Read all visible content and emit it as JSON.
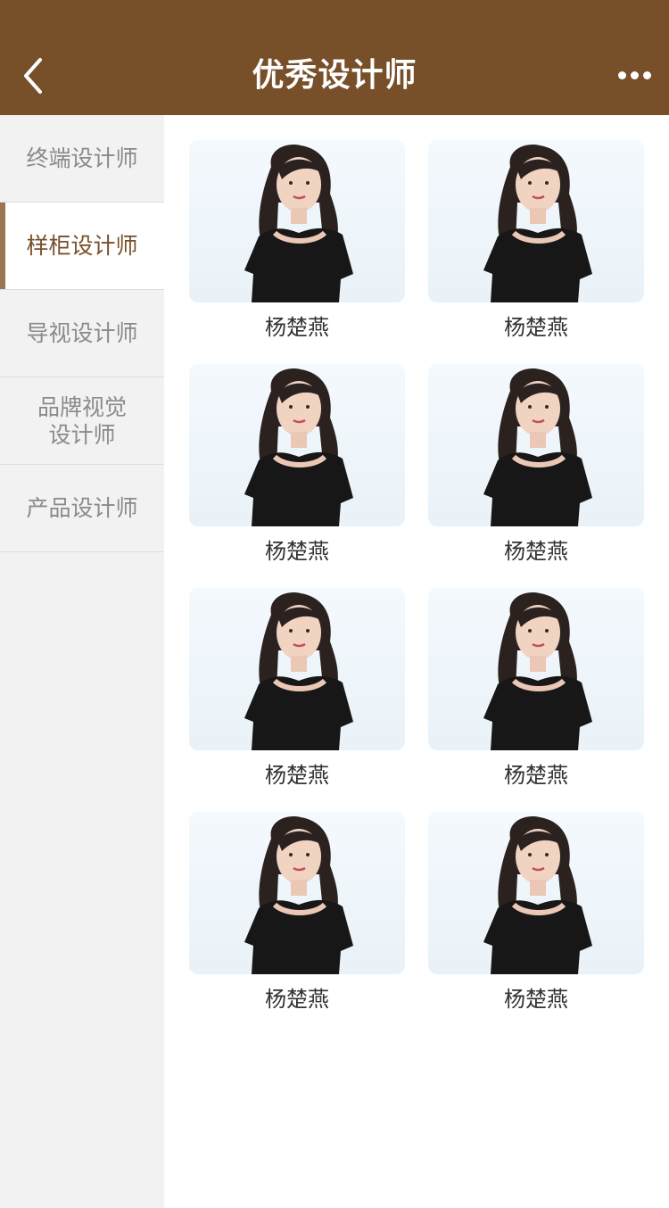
{
  "header": {
    "title": "优秀设计师",
    "back_icon": "chevron-left-icon",
    "more_icon": "more-dots-icon",
    "color": "#774f29"
  },
  "sidebar": {
    "items": [
      {
        "label": "终端设计师",
        "active": false
      },
      {
        "label": "样柜设计师",
        "active": true
      },
      {
        "label": "导视设计师",
        "active": false
      },
      {
        "label": "品牌视觉\n设计师",
        "active": false
      },
      {
        "label": "产品设计师",
        "active": false
      }
    ]
  },
  "designers": [
    {
      "name": "杨楚燕"
    },
    {
      "name": "杨楚燕"
    },
    {
      "name": "杨楚燕"
    },
    {
      "name": "杨楚燕"
    },
    {
      "name": "杨楚燕"
    },
    {
      "name": "杨楚燕"
    },
    {
      "name": "杨楚燕"
    },
    {
      "name": "杨楚燕"
    }
  ]
}
